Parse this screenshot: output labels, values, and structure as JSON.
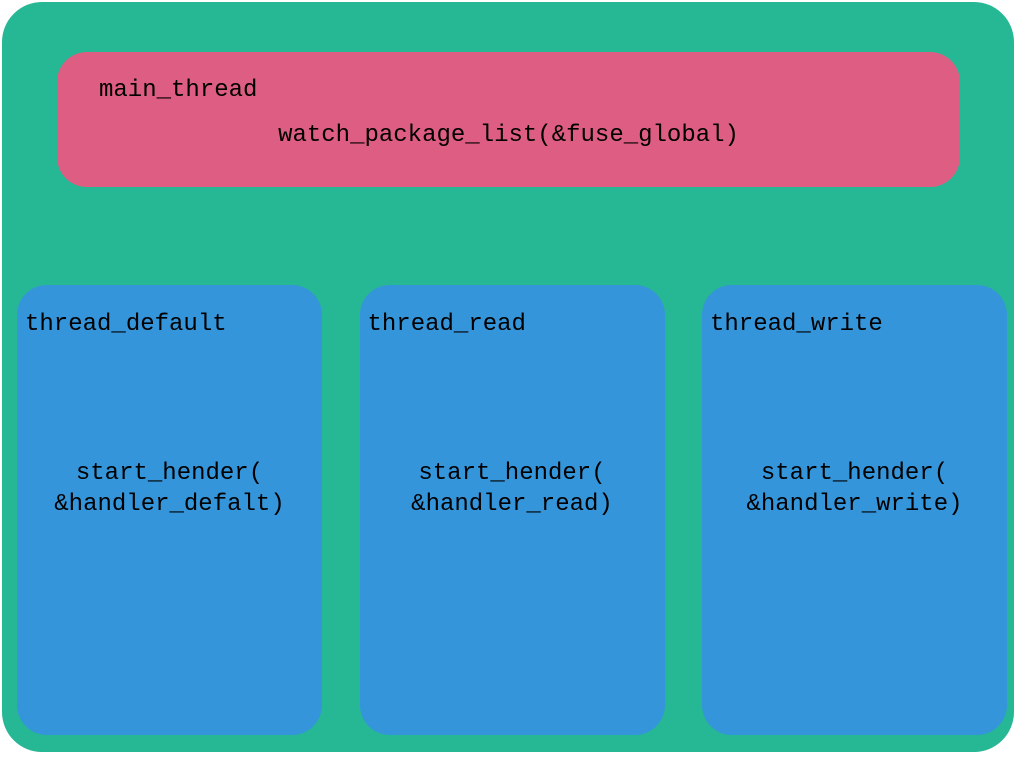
{
  "main_thread": {
    "title": "main_thread",
    "call": "watch_package_list(&fuse_global)"
  },
  "threads": {
    "default": {
      "title": "thread_default",
      "call_line1": "start_hender(",
      "call_line2": "&handler_defalt)"
    },
    "read": {
      "title": "thread_read",
      "call_line1": "start_hender(",
      "call_line2": "&handler_read)"
    },
    "write": {
      "title": "thread_write",
      "call_line1": "start_hender(",
      "call_line2": "&handler_write)"
    }
  }
}
